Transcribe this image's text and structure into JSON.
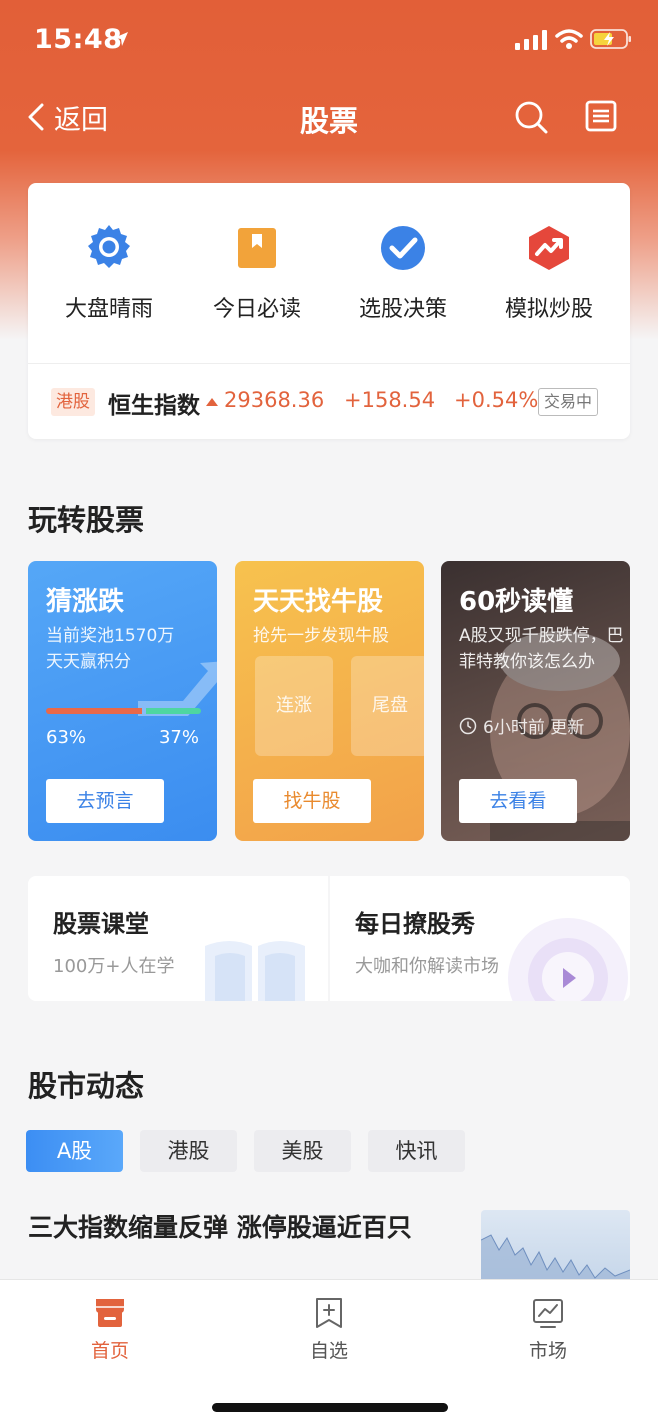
{
  "status_bar": {
    "time": "15:48"
  },
  "nav": {
    "back_label": "返回",
    "title": "股票"
  },
  "quick_actions": [
    {
      "label": "大盘晴雨",
      "icon": "gear-icon",
      "color": "#3b82e6"
    },
    {
      "label": "今日必读",
      "icon": "bookmark-icon",
      "color": "#f2a33a"
    },
    {
      "label": "选股决策",
      "icon": "check-icon",
      "color": "#3b82e6"
    },
    {
      "label": "模拟炒股",
      "icon": "trend-icon",
      "color": "#e5473b"
    }
  ],
  "index": {
    "tag": "港股",
    "name": "恒生指数",
    "price": "29368.36",
    "change": "+158.54",
    "percent": "+0.54%",
    "status": "交易中",
    "color": "#e2633d"
  },
  "section_play": {
    "title": "玩转股票"
  },
  "cards": {
    "guess": {
      "title": "猜涨跌",
      "sub1": "当前奖池1570万",
      "sub2": "天天赢积分",
      "up_pct": "63%",
      "down_pct": "37%",
      "button": "去预言"
    },
    "bull": {
      "title": "天天找牛股",
      "sub": "抢先一步发现牛股",
      "box1": "连涨",
      "box2": "尾盘",
      "button": "找牛股"
    },
    "read60": {
      "title": "60秒读懂",
      "sub": "A股又现千股跌停，巴菲特教你该怎么办",
      "time": "6小时前 更新",
      "button": "去看看"
    }
  },
  "courses": [
    {
      "title": "股票课堂",
      "sub": "100万+人在学"
    },
    {
      "title": "每日撩股秀",
      "sub": "大咖和你解读市场"
    }
  ],
  "section_market": {
    "title": "股市动态"
  },
  "tabs": [
    "A股",
    "港股",
    "美股",
    "快讯"
  ],
  "news": {
    "title": "三大指数缩量反弹 涨停股逼近百只"
  },
  "bottom_nav": [
    {
      "label": "首页",
      "icon": "home-store-icon"
    },
    {
      "label": "自选",
      "icon": "add-watchlist-icon"
    },
    {
      "label": "市场",
      "icon": "market-chart-icon"
    }
  ],
  "colors": {
    "brand": "#e2633d",
    "accent_blue": "#3b82e6"
  }
}
